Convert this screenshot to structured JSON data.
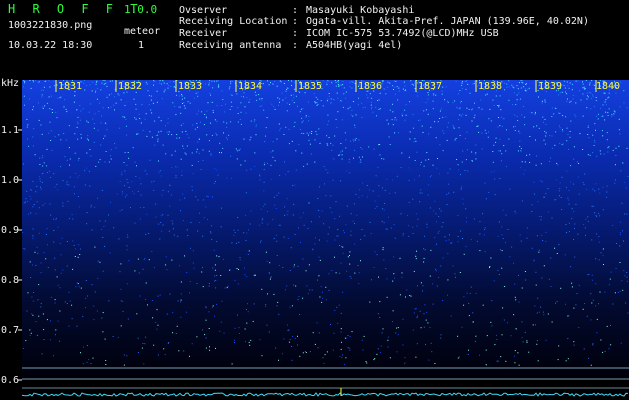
{
  "header": {
    "app_title": "H R O F F T",
    "app_version": "1.0.0",
    "file_name": "1003221830.png",
    "timestamp": "10.03.22 18:30",
    "meteor_label": "meteor",
    "meteor_count": "1",
    "info": [
      {
        "key": "Ovserver",
        "value": "Masayuki Kobayashi"
      },
      {
        "key": "Receiving Location",
        "value": "Ogata-vill. Akita-Pref. JAPAN (139.96E, 40.02N)"
      },
      {
        "key": "Receiver",
        "value": "ICOM IC-575 53.7492(@LCD)MHz USB"
      },
      {
        "key": "Receiving antenna",
        "value": "A504HB(yagi 4el)"
      }
    ],
    "separator": ":"
  },
  "spectrogram": {
    "y_unit": "kHz",
    "y_ticks": [
      "1.1",
      "1.0",
      "0.9",
      "0.8",
      "0.7",
      "0.6"
    ],
    "x_ticks": [
      "1831",
      "1832",
      "1833",
      "1834",
      "1835",
      "1836",
      "1837",
      "1838",
      "1839",
      "1840"
    ],
    "colors": {
      "background": "#000000",
      "noise_low": "#001a55",
      "noise_mid": "#0a3cff",
      "noise_high": "#33ffcc",
      "grid": "#7a9ab0",
      "label_y": "#f2f2f2",
      "label_x": "#ffff33"
    }
  }
}
